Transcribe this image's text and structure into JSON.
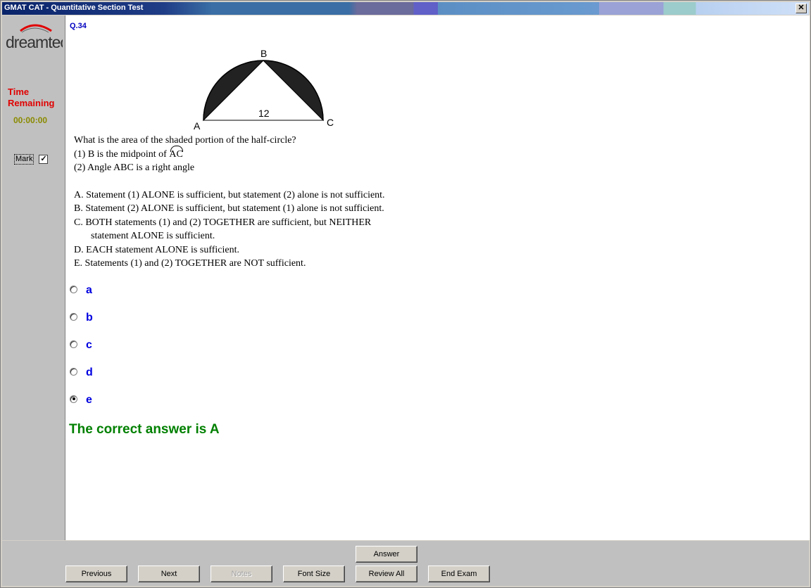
{
  "window": {
    "title": "GMAT CAT - Quantitative Section Test",
    "close_glyph": "✕"
  },
  "sidebar": {
    "logo_text": "dreamtech",
    "time_label_line1": "Time",
    "time_label_line2": "Remaining",
    "time_value": "00:00:00",
    "mark_label": "Mark",
    "mark_checked": "✓"
  },
  "question": {
    "number": "Q.34",
    "diagram": {
      "point_a": "A",
      "point_b": "B",
      "point_c": "C",
      "length_label": "12"
    },
    "prompt": "What is the area of the shaded portion of the half-circle?",
    "statement1_prefix": "(1) B is the midpoint of ",
    "statement1_arc": "AC",
    "statement2": "(2) Angle ABC is a right angle",
    "options": {
      "a": "A. Statement (1) ALONE is sufficient, but statement (2) alone is not sufficient.",
      "b": "B. Statement (2) ALONE is sufficient, but statement (1) alone is not sufficient.",
      "c_line1": "C. BOTH statements (1) and (2) TOGETHER are sufficient, but NEITHER",
      "c_line2": "statement ALONE is sufficient.",
      "d": "D. EACH statement ALONE is sufficient.",
      "e": "E. Statements (1) and (2) TOGETHER are NOT sufficient."
    }
  },
  "choices": [
    {
      "label": "a",
      "selected": false
    },
    {
      "label": "b",
      "selected": false
    },
    {
      "label": "c",
      "selected": false
    },
    {
      "label": "d",
      "selected": false
    },
    {
      "label": "e",
      "selected": true
    }
  ],
  "feedback": {
    "correct_answer": "The correct answer is A"
  },
  "buttons": {
    "answer": "Answer",
    "previous": "Previous",
    "next": "Next",
    "notes": "Notes",
    "font_size": "Font Size",
    "review_all": "Review All",
    "end_exam": "End Exam"
  }
}
